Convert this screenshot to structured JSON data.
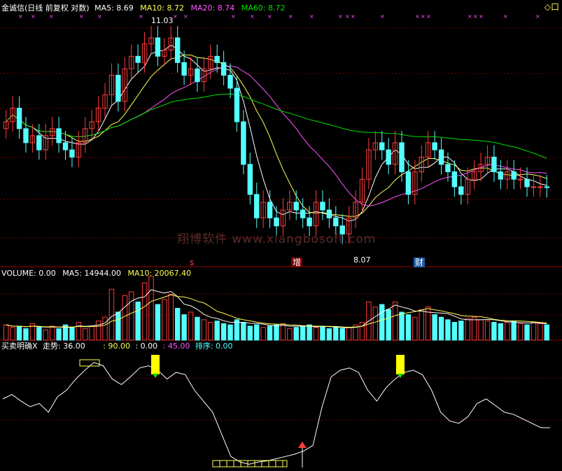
{
  "header": {
    "title": "金诚信(日线 前复权 对数)",
    "ma5": "MA5: 8.69",
    "ma10": "MA10: 8.72",
    "ma20": "MA20: 8.74",
    "ma60": "MA60: 8.72",
    "right_icon": "◇口"
  },
  "volume_header": {
    "title": "VOLUME: 0.00",
    "ma5": "MA5: 14944.00",
    "ma10": "MA10: 20067.40"
  },
  "indicator_header": {
    "title": "买卖明确X",
    "trend": "走势: 36.00",
    "v90": ": 90.00",
    "v0": ": 0.00",
    "v45": ": 45.00",
    "sort": "排序: 0.00"
  },
  "annotations": {
    "high": "11.03",
    "low": "8.07",
    "marker1": "s",
    "marker2": "增",
    "marker3": "财",
    "watermark": "翔博软件 www.xiangbosoft.com"
  },
  "colors": {
    "up": "#ff3c3c",
    "down": "#54ffff",
    "ma5": "#ffffff",
    "ma10": "#ffff54",
    "ma20": "#ff54ff",
    "ma60": "#00e000",
    "grid": "#7a0000"
  },
  "chart_data": [
    {
      "type": "candlestick",
      "title": "金诚信(日线 前复权 对数)",
      "y_scale": "log",
      "ylim": [
        7.8,
        11.3
      ],
      "series": [
        {
          "name": "MA5",
          "last": 8.69
        },
        {
          "name": "MA10",
          "last": 8.72
        },
        {
          "name": "MA20",
          "last": 8.74
        },
        {
          "name": "MA60",
          "last": 8.72
        }
      ],
      "close": [
        9.6,
        9.8,
        9.5,
        9.3,
        9.4,
        9.2,
        9.4,
        9.5,
        9.3,
        9.2,
        9.1,
        9.3,
        9.5,
        9.6,
        9.8,
        10.0,
        10.3,
        9.9,
        10.4,
        10.6,
        10.5,
        10.8,
        10.9,
        10.6,
        10.7,
        10.9,
        10.5,
        10.3,
        10.4,
        10.2,
        10.4,
        10.6,
        10.5,
        10.3,
        10.1,
        9.6,
        9.0,
        8.6,
        8.3,
        8.5,
        8.3,
        8.2,
        8.4,
        8.5,
        8.4,
        8.3,
        8.2,
        8.5,
        8.4,
        8.3,
        8.2,
        8.1,
        8.3,
        8.5,
        8.8,
        9.2,
        9.3,
        9.2,
        9.0,
        9.3,
        8.9,
        8.6,
        8.9,
        9.1,
        9.3,
        9.2,
        9.0,
        8.9,
        8.7,
        8.6,
        8.8,
        8.9,
        9.0,
        9.1,
        8.9,
        8.8,
        8.9,
        8.8,
        8.8,
        8.7,
        8.7,
        8.7,
        8.69
      ],
      "annotations": [
        "11.03",
        "8.07"
      ]
    },
    {
      "type": "bar",
      "title": "VOLUME: 0.00",
      "series": [
        {
          "name": "MA5",
          "last": 14944.0
        },
        {
          "name": "MA10",
          "last": 20067.4
        }
      ],
      "values": [
        12,
        10,
        11,
        9,
        13,
        10,
        8,
        11,
        9,
        12,
        10,
        14,
        9,
        11,
        15,
        18,
        40,
        22,
        35,
        38,
        30,
        45,
        50,
        28,
        32,
        36,
        25,
        20,
        22,
        18,
        16,
        14,
        15,
        13,
        12,
        16,
        14,
        11,
        12,
        10,
        11,
        12,
        13,
        9,
        10,
        11,
        12,
        10,
        11,
        9,
        10,
        9,
        10,
        12,
        14,
        30,
        26,
        28,
        24,
        30,
        22,
        20,
        18,
        24,
        26,
        20,
        18,
        16,
        14,
        15,
        17,
        18,
        16,
        15,
        14,
        13,
        14,
        15,
        13,
        12,
        14,
        13,
        12
      ]
    },
    {
      "type": "line",
      "title": "买卖明确X",
      "series": [
        {
          "name": "走势",
          "last": 36.0
        },
        {
          "name": "排序",
          "last": 0.0
        }
      ],
      "reference_lines": [
        90,
        45,
        0
      ],
      "values": [
        62,
        66,
        60,
        55,
        58,
        50,
        64,
        70,
        80,
        88,
        95,
        92,
        80,
        75,
        82,
        90,
        92,
        88,
        80,
        86,
        84,
        70,
        60,
        50,
        30,
        10,
        5,
        3,
        5,
        6,
        8,
        10,
        12,
        15,
        20,
        55,
        82,
        88,
        90,
        86,
        70,
        60,
        72,
        80,
        86,
        88,
        84,
        70,
        50,
        42,
        40,
        46,
        58,
        62,
        56,
        50,
        48,
        44,
        40,
        36,
        36
      ]
    }
  ]
}
